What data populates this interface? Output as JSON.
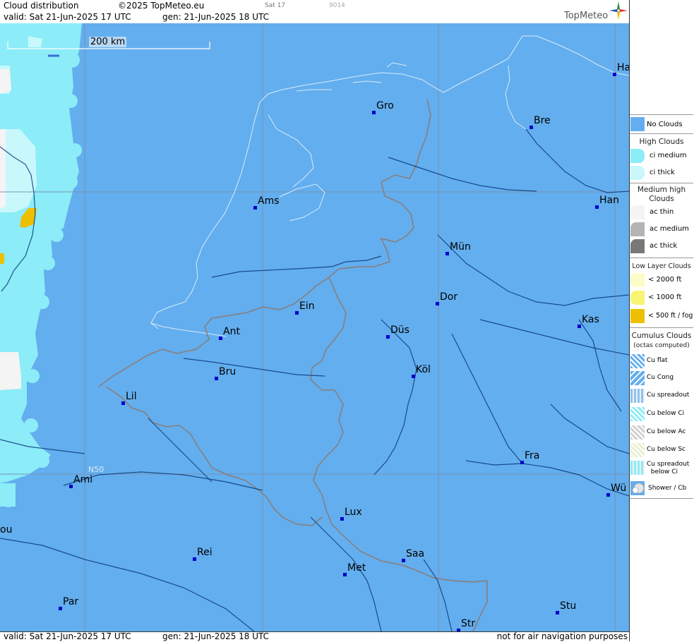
{
  "header": {
    "title": "Cloud distribution",
    "copyright": "©2025 TopMeteo.eu",
    "sat_label": "Sat 17",
    "code": "9014",
    "valid": "valid:  Sat  21-Jun-2025  17 UTC",
    "generated": "gen: 21-Jun-2025 18 UTC",
    "brand": "TopMeteo"
  },
  "map": {
    "scale_label": "200 km",
    "lat_label": "N50",
    "cities": [
      {
        "name": "Ha"
      },
      {
        "name": "Gro"
      },
      {
        "name": "Bre"
      },
      {
        "name": "Ams"
      },
      {
        "name": "Han"
      },
      {
        "name": "Mün"
      },
      {
        "name": "Ein"
      },
      {
        "name": "Dor"
      },
      {
        "name": "Ant"
      },
      {
        "name": "Düs"
      },
      {
        "name": "Kas"
      },
      {
        "name": "Bru"
      },
      {
        "name": "Köl"
      },
      {
        "name": "Lil"
      },
      {
        "name": "Fra"
      },
      {
        "name": "Ami"
      },
      {
        "name": "Wü"
      },
      {
        "name": "Lux"
      },
      {
        "name": "ou"
      },
      {
        "name": "Rei"
      },
      {
        "name": "Saa"
      },
      {
        "name": "Met"
      },
      {
        "name": "Par"
      },
      {
        "name": "Stu"
      },
      {
        "name": "Str"
      }
    ]
  },
  "footer": {
    "valid": "valid:  Sat  21-Jun-2025  17 UTC",
    "generated": "gen: 21-Jun-2025 18 UTC",
    "note": "not for air navigation purposes"
  },
  "legend": {
    "no_clouds": "No Clouds",
    "high_title": "High Clouds",
    "ci_medium": "ci medium",
    "ci_thick": "ci thick",
    "medium_title_1": "Medium high",
    "medium_title_2": "Clouds",
    "ac_thin": "ac thin",
    "ac_medium": "ac medium",
    "ac_thick": "ac thick",
    "low_title": "Low Layer Clouds",
    "lt2000": "< 2000 ft",
    "lt1000": "< 1000 ft",
    "lt500": "< 500 ft / fog",
    "cu_title_1": "Cumulus Clouds",
    "cu_title_2": "(octas computed)",
    "cu_flat": "Cu flat",
    "cu_cong": "Cu Cong",
    "cu_spreadout": "Cu spreadout",
    "cu_below_ci": "Cu below Ci",
    "cu_below_ac": "Cu below Ac",
    "cu_below_sc": "Cu below Sc",
    "cu_spread_below_ci_1": "Cu spreadout",
    "cu_spread_below_ci_2": "below Ci",
    "shower": "Shower / Cb",
    "colors": {
      "no_clouds": "#63aeee",
      "ci_medium": "#8cecf8",
      "ci_thick": "#c8f8fc",
      "ac_thin": "#f4f4f4",
      "ac_medium": "#b4b4b4",
      "ac_thick": "#787878",
      "lt2000": "#fcfcc8",
      "lt1000": "#f8f474",
      "lt500": "#ecc000"
    }
  }
}
